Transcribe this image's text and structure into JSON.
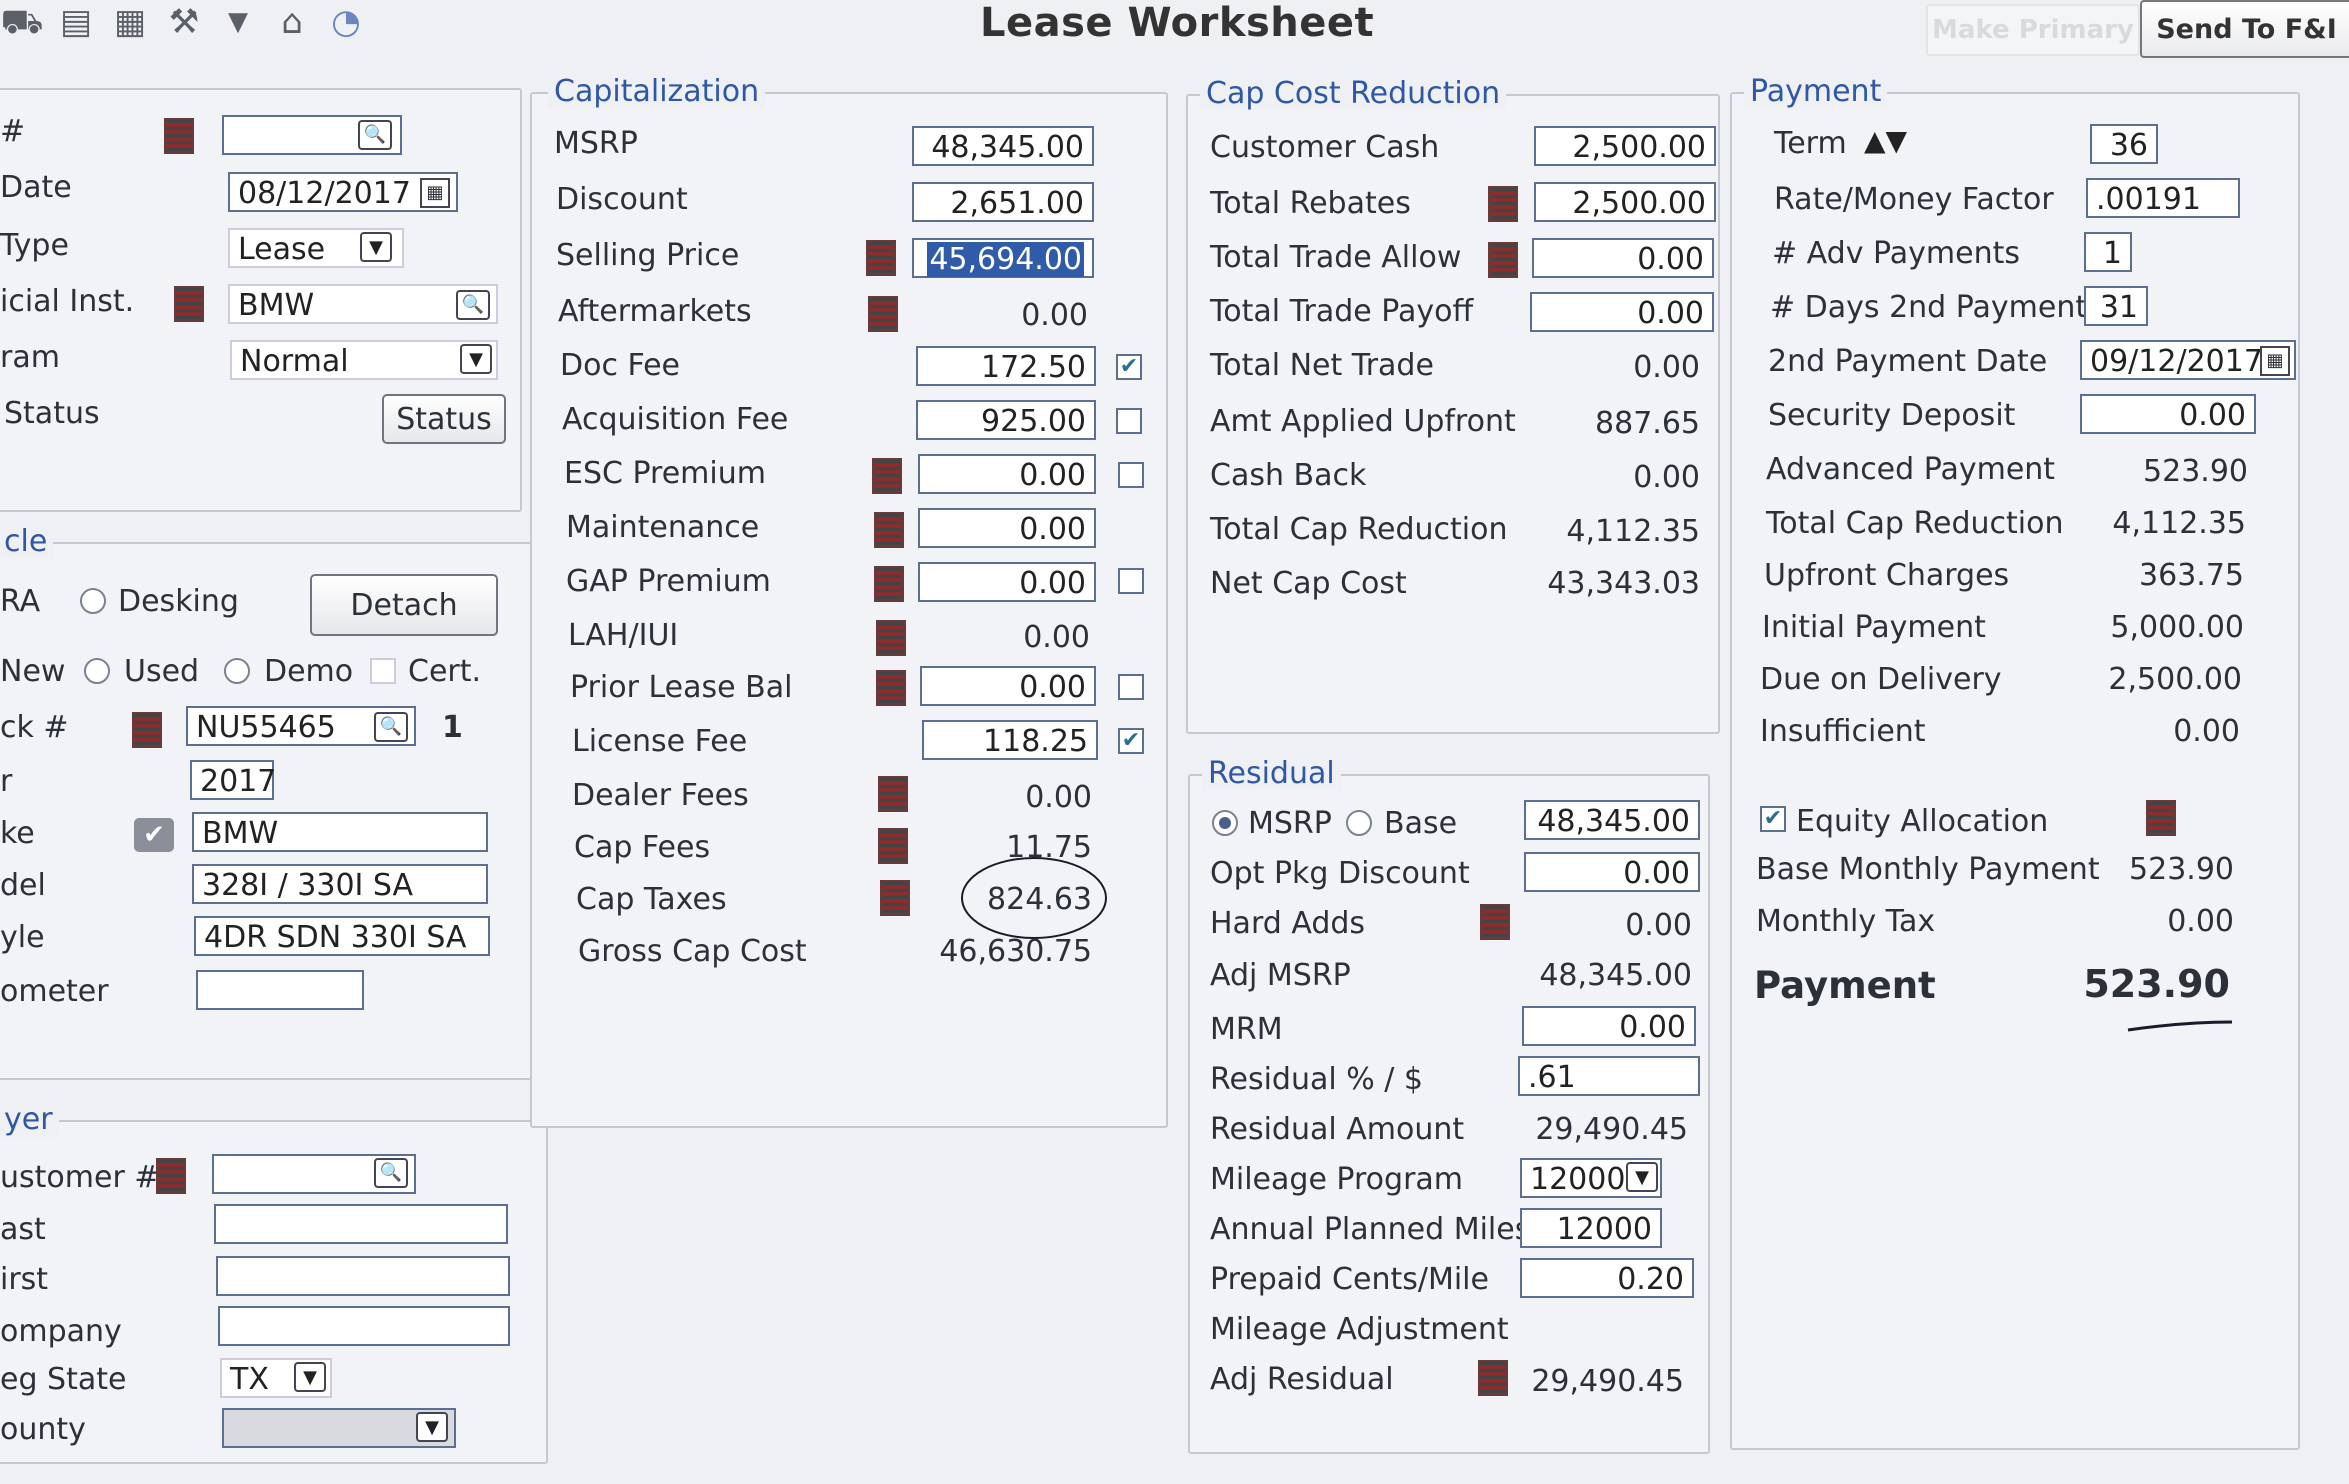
{
  "toolbar": {
    "icons": [
      "car-icon",
      "document-icon",
      "calculator-icon",
      "hammer-icon",
      "chevron-down-icon",
      "home-icon",
      "car-wash-icon"
    ],
    "make_primary_label": "Make Primary",
    "send_label": "Send To F&I"
  },
  "title": "Lease Worksheet",
  "deal": {
    "number_label": "#",
    "date_label": "Date",
    "date_value": "08/12/2017",
    "type_label": "Type",
    "type_value": "Lease",
    "financial_label": "icial Inst.",
    "financial_value": "BMW",
    "program_label": "ram",
    "program_value": "Normal",
    "status_label": "Status",
    "status_button": "Status"
  },
  "vehicle": {
    "legend": "cle",
    "era_label": "RA",
    "desking_label": "Desking",
    "detach_button": "Detach",
    "new_label": "New",
    "used_label": "Used",
    "demo_label": "Demo",
    "cert_label": "Cert.",
    "stock_label": "ck #",
    "stock_value": "NU55465",
    "stock_count": "1",
    "year_label": "r",
    "year_value": "2017",
    "make_label": "ke",
    "make_value": "BMW",
    "model_label": "del",
    "model_value": "328I / 330I SA",
    "style_label": "yle",
    "style_value": "4DR SDN 330I SA",
    "odometer_label": "ometer",
    "odometer_value": ""
  },
  "buyer": {
    "legend": "yer",
    "customer_label": "ustomer #",
    "last_label": "ast",
    "first_label": "irst",
    "company_label": "ompany",
    "reg_state_label": "eg State",
    "reg_state_value": "TX",
    "county_label": "ounty"
  },
  "capitalization": {
    "legend": "Capitalization",
    "rows": [
      {
        "label": "MSRP",
        "value": "48,345.00"
      },
      {
        "label": "Discount",
        "value": "2,651.00"
      },
      {
        "label": "Selling Price",
        "value": "45,694.00"
      },
      {
        "label": "Aftermarkets",
        "value": "0.00"
      },
      {
        "label": "Doc Fee",
        "value": "172.50"
      },
      {
        "label": "Acquisition Fee",
        "value": "925.00"
      },
      {
        "label": "ESC Premium",
        "value": "0.00"
      },
      {
        "label": "Maintenance",
        "value": "0.00"
      },
      {
        "label": "GAP Premium",
        "value": "0.00"
      },
      {
        "label": "LAH/IUI",
        "value": "0.00"
      },
      {
        "label": "Prior Lease Bal",
        "value": "0.00"
      },
      {
        "label": "License Fee",
        "value": "118.25"
      },
      {
        "label": "Dealer Fees",
        "value": "0.00"
      },
      {
        "label": "Cap Fees",
        "value": "11.75"
      },
      {
        "label": "Cap Taxes",
        "value": "824.63"
      },
      {
        "label": "Gross Cap Cost",
        "value": "46,630.75"
      }
    ]
  },
  "cap_cost_reduction": {
    "legend": "Cap Cost Reduction",
    "rows": [
      {
        "label": "Customer Cash",
        "value": "2,500.00"
      },
      {
        "label": "Total Rebates",
        "value": "2,500.00"
      },
      {
        "label": "Total Trade Allow",
        "value": "0.00"
      },
      {
        "label": "Total Trade Payoff",
        "value": "0.00"
      },
      {
        "label": "Total Net Trade",
        "value": "0.00"
      },
      {
        "label": "Amt Applied Upfront",
        "value": "887.65"
      },
      {
        "label": "Cash Back",
        "value": "0.00"
      },
      {
        "label": "Total Cap Reduction",
        "value": "4,112.35"
      },
      {
        "label": "Net Cap Cost",
        "value": "43,343.03"
      }
    ]
  },
  "residual": {
    "legend": "Residual",
    "msrp_radio": "MSRP",
    "base_radio": "Base",
    "rows": [
      {
        "label": "",
        "value": "48,345.00"
      },
      {
        "label": "Opt Pkg Discount",
        "value": "0.00"
      },
      {
        "label": "Hard Adds",
        "value": "0.00"
      },
      {
        "label": "Adj MSRP",
        "value": "48,345.00"
      },
      {
        "label": "MRM",
        "value": "0.00"
      },
      {
        "label": "Residual % / $",
        "value": ".61"
      },
      {
        "label": "Residual Amount",
        "value": "29,490.45"
      },
      {
        "label": "Mileage Program",
        "value": "12000"
      },
      {
        "label": "Annual Planned Miles",
        "value": "12000"
      },
      {
        "label": "Prepaid Cents/Mile",
        "value": "0.20"
      },
      {
        "label": "Mileage Adjustment",
        "value": ""
      },
      {
        "label": "Adj Residual",
        "value": "29,490.45"
      }
    ]
  },
  "payment": {
    "legend": "Payment",
    "rows": [
      {
        "label": "Term",
        "value": "36"
      },
      {
        "label": "Rate/Money Factor",
        "value": ".00191"
      },
      {
        "label": "# Adv Payments",
        "value": "1"
      },
      {
        "label": "# Days 2nd Payment",
        "value": "31"
      },
      {
        "label": "2nd Payment Date",
        "value": "09/12/2017"
      },
      {
        "label": "Security Deposit",
        "value": "0.00"
      },
      {
        "label": "Advanced Payment",
        "value": "523.90"
      },
      {
        "label": "Total Cap Reduction",
        "value": "4,112.35"
      },
      {
        "label": "Upfront Charges",
        "value": "363.75"
      },
      {
        "label": "Initial Payment",
        "value": "5,000.00"
      },
      {
        "label": "Due on Delivery",
        "value": "2,500.00"
      },
      {
        "label": "Insufficient",
        "value": "0.00"
      }
    ],
    "equity_label": "Equity Allocation",
    "base_monthly_label": "Base Monthly Payment",
    "base_monthly_value": "523.90",
    "monthly_tax_label": "Monthly Tax",
    "monthly_tax_value": "0.00",
    "payment_label": "Payment",
    "payment_value": "523.90"
  }
}
